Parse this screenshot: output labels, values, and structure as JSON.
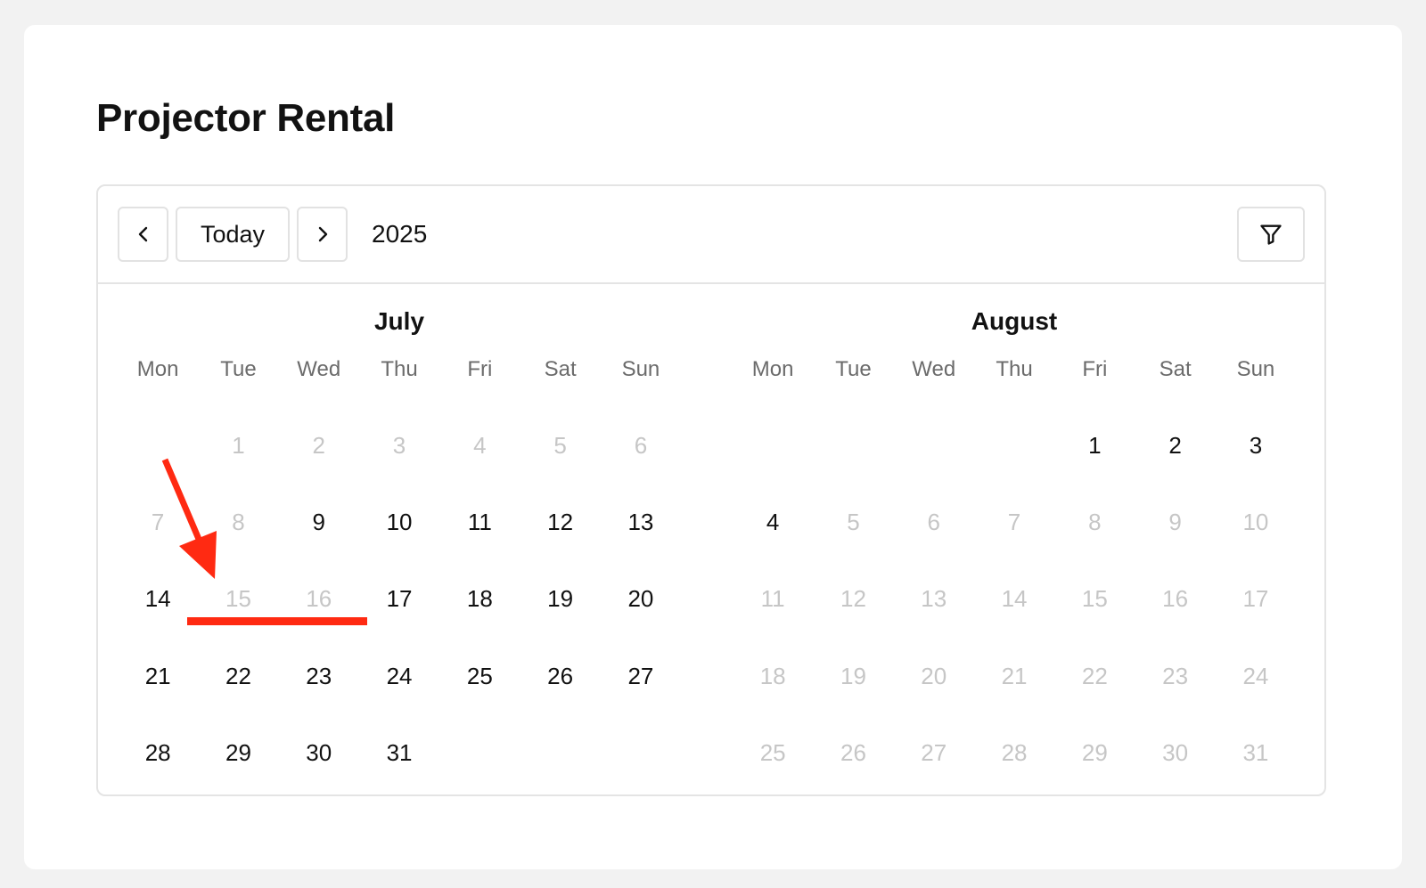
{
  "page": {
    "title": "Projector Rental"
  },
  "toolbar": {
    "prev_icon": "chevron-left-icon",
    "today_label": "Today",
    "next_icon": "chevron-right-icon",
    "year": "2025",
    "filter_icon": "filter-icon"
  },
  "weekdays": [
    "Mon",
    "Tue",
    "Wed",
    "Thu",
    "Fri",
    "Sat",
    "Sun"
  ],
  "months": [
    {
      "name": "July",
      "days": [
        {
          "label": "",
          "state": "empty"
        },
        {
          "label": "1",
          "state": "disabled"
        },
        {
          "label": "2",
          "state": "disabled"
        },
        {
          "label": "3",
          "state": "disabled"
        },
        {
          "label": "4",
          "state": "disabled"
        },
        {
          "label": "5",
          "state": "disabled"
        },
        {
          "label": "6",
          "state": "disabled"
        },
        {
          "label": "7",
          "state": "disabled"
        },
        {
          "label": "8",
          "state": "disabled"
        },
        {
          "label": "9",
          "state": "available"
        },
        {
          "label": "10",
          "state": "available"
        },
        {
          "label": "11",
          "state": "available"
        },
        {
          "label": "12",
          "state": "available"
        },
        {
          "label": "13",
          "state": "available"
        },
        {
          "label": "14",
          "state": "available"
        },
        {
          "label": "15",
          "state": "disabled"
        },
        {
          "label": "16",
          "state": "disabled"
        },
        {
          "label": "17",
          "state": "available"
        },
        {
          "label": "18",
          "state": "available"
        },
        {
          "label": "19",
          "state": "available"
        },
        {
          "label": "20",
          "state": "available"
        },
        {
          "label": "21",
          "state": "available"
        },
        {
          "label": "22",
          "state": "available"
        },
        {
          "label": "23",
          "state": "available"
        },
        {
          "label": "24",
          "state": "available"
        },
        {
          "label": "25",
          "state": "available"
        },
        {
          "label": "26",
          "state": "available"
        },
        {
          "label": "27",
          "state": "available"
        },
        {
          "label": "28",
          "state": "available"
        },
        {
          "label": "29",
          "state": "available"
        },
        {
          "label": "30",
          "state": "available"
        },
        {
          "label": "31",
          "state": "available"
        }
      ]
    },
    {
      "name": "August",
      "days": [
        {
          "label": "",
          "state": "empty"
        },
        {
          "label": "",
          "state": "empty"
        },
        {
          "label": "",
          "state": "empty"
        },
        {
          "label": "",
          "state": "empty"
        },
        {
          "label": "1",
          "state": "available"
        },
        {
          "label": "2",
          "state": "available"
        },
        {
          "label": "3",
          "state": "available"
        },
        {
          "label": "4",
          "state": "available"
        },
        {
          "label": "5",
          "state": "disabled"
        },
        {
          "label": "6",
          "state": "disabled"
        },
        {
          "label": "7",
          "state": "disabled"
        },
        {
          "label": "8",
          "state": "disabled"
        },
        {
          "label": "9",
          "state": "disabled"
        },
        {
          "label": "10",
          "state": "disabled"
        },
        {
          "label": "11",
          "state": "disabled"
        },
        {
          "label": "12",
          "state": "disabled"
        },
        {
          "label": "13",
          "state": "disabled"
        },
        {
          "label": "14",
          "state": "disabled"
        },
        {
          "label": "15",
          "state": "disabled"
        },
        {
          "label": "16",
          "state": "disabled"
        },
        {
          "label": "17",
          "state": "disabled"
        },
        {
          "label": "18",
          "state": "disabled"
        },
        {
          "label": "19",
          "state": "disabled"
        },
        {
          "label": "20",
          "state": "disabled"
        },
        {
          "label": "21",
          "state": "disabled"
        },
        {
          "label": "22",
          "state": "disabled"
        },
        {
          "label": "23",
          "state": "disabled"
        },
        {
          "label": "24",
          "state": "disabled"
        },
        {
          "label": "25",
          "state": "disabled"
        },
        {
          "label": "26",
          "state": "disabled"
        },
        {
          "label": "27",
          "state": "disabled"
        },
        {
          "label": "28",
          "state": "disabled"
        },
        {
          "label": "29",
          "state": "disabled"
        },
        {
          "label": "30",
          "state": "disabled"
        },
        {
          "label": "31",
          "state": "disabled"
        }
      ]
    }
  ],
  "colors": {
    "text": "#111111",
    "disabled_text": "#c6c6c6",
    "weekday_text": "#6b6b6b",
    "border": "#e4e4e4",
    "annotation": "#ff2a12",
    "page_background": "#f2f2f2"
  },
  "annotation": {
    "arrow_icon": "red-arrow-icon",
    "underline_icon": "red-underline-icon"
  }
}
